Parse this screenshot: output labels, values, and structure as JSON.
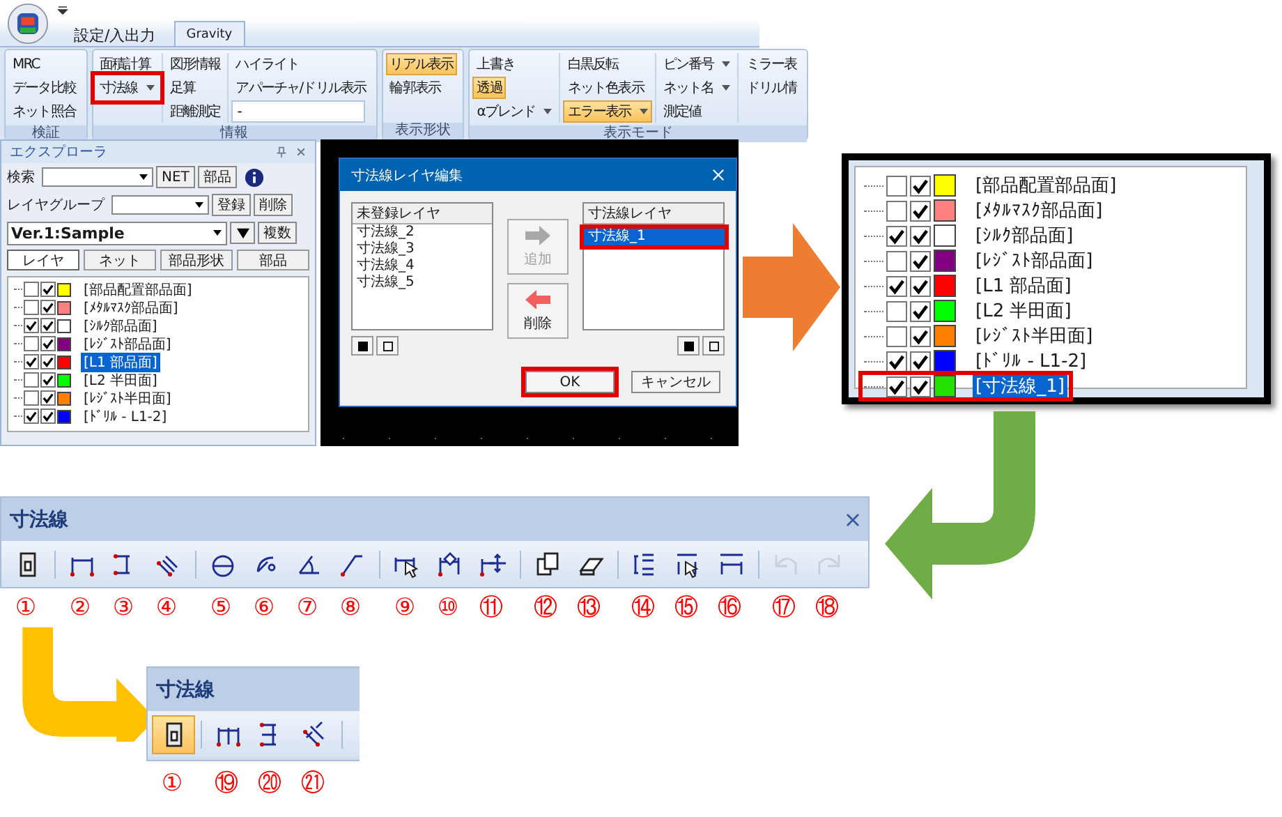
{
  "ribbon": {
    "tabs": [
      {
        "label": "設定/入出力",
        "selected": false
      },
      {
        "label": "Gravity",
        "selected": true
      }
    ],
    "groups": [
      {
        "label": "検証",
        "columns": [
          [
            {
              "kind": "button",
              "label": "MRC",
              "active": false,
              "marked": false
            },
            {
              "kind": "button",
              "label": "データ比較",
              "active": false,
              "marked": false
            },
            {
              "kind": "button",
              "label": "ネット照合",
              "active": false,
              "marked": false
            }
          ]
        ]
      },
      {
        "label": "情報",
        "columns": [
          [
            {
              "kind": "button",
              "label": "面積計算",
              "active": false,
              "marked": false
            },
            {
              "kind": "dropdown",
              "label": "寸法線",
              "active": false,
              "marked": true
            }
          ],
          [
            {
              "kind": "button",
              "label": "図形情報",
              "active": false,
              "marked": false
            },
            {
              "kind": "button",
              "label": "足算",
              "active": false,
              "marked": false
            },
            {
              "kind": "button",
              "label": "距離測定",
              "active": false,
              "marked": false
            }
          ],
          [
            {
              "kind": "button",
              "label": "ハイライト",
              "active": false,
              "marked": false
            },
            {
              "kind": "button",
              "label": "アパーチャ/ドリル表示",
              "active": false,
              "marked": false
            },
            {
              "kind": "field",
              "label": "-"
            }
          ]
        ]
      },
      {
        "label": "表示形状",
        "columns": [
          [
            {
              "kind": "button",
              "label": "リアル表示",
              "active": true,
              "marked": false
            },
            {
              "kind": "button",
              "label": "輪郭表示",
              "active": false,
              "marked": false
            }
          ]
        ]
      },
      {
        "label": "表示モード",
        "columns": [
          [
            {
              "kind": "button",
              "label": "上書き",
              "active": false,
              "marked": false
            },
            {
              "kind": "button",
              "label": "透過",
              "active": true,
              "marked": false
            },
            {
              "kind": "dropdown",
              "label": "αブレンド",
              "active": false,
              "marked": false
            }
          ],
          [
            {
              "kind": "button",
              "label": "白黒反転",
              "active": false,
              "marked": false
            },
            {
              "kind": "button",
              "label": "ネット色表示",
              "active": false,
              "marked": false
            },
            {
              "kind": "dropdown",
              "label": "エラー表示",
              "active": true,
              "marked": false
            }
          ],
          [
            {
              "kind": "dropdown",
              "label": "ピン番号",
              "active": false,
              "marked": false
            },
            {
              "kind": "dropdown",
              "label": "ネット名",
              "active": false,
              "marked": false
            },
            {
              "kind": "button",
              "label": "測定値",
              "active": false,
              "marked": false
            }
          ],
          [
            {
              "kind": "button",
              "label": "ミラー表",
              "active": false,
              "marked": false
            },
            {
              "kind": "button",
              "label": "ドリル情",
              "active": false,
              "marked": false
            }
          ]
        ]
      }
    ]
  },
  "explorer": {
    "title": "エクスプローラ",
    "search_label": "検索",
    "net_button": "NET",
    "parts_button": "部品",
    "layer_group_label": "レイヤグループ",
    "register_button": "登録",
    "delete_button": "削除",
    "version": "Ver.1:Sample",
    "multi_button": "複数",
    "tabs": [
      {
        "label": "レイヤ",
        "selected": true
      },
      {
        "label": "ネット",
        "selected": false
      },
      {
        "label": "部品形状",
        "selected": false
      },
      {
        "label": "部品",
        "selected": false
      }
    ],
    "layers": [
      {
        "name": "[部品配置部品面]",
        "checked": false,
        "visible": true,
        "color": "#ffff00",
        "selected": false
      },
      {
        "name": "[ﾒﾀﾙﾏｽｸ部品面]",
        "checked": false,
        "visible": true,
        "color": "#ff8080",
        "selected": false
      },
      {
        "name": "[ｼﾙｸ部品面]",
        "checked": true,
        "visible": true,
        "color": "#ffffff",
        "selected": false
      },
      {
        "name": "[ﾚｼﾞｽﾄ部品面]",
        "checked": false,
        "visible": true,
        "color": "#800080",
        "selected": false
      },
      {
        "name": "[L1 部品面]",
        "checked": true,
        "visible": true,
        "color": "#ff0000",
        "selected": true
      },
      {
        "name": "[L2 半田面]",
        "checked": false,
        "visible": true,
        "color": "#00ff00",
        "selected": false
      },
      {
        "name": "[ﾚｼﾞｽﾄ半田面]",
        "checked": false,
        "visible": true,
        "color": "#ff8000",
        "selected": false
      },
      {
        "name": "[ﾄﾞﾘﾙ - L1-2]",
        "checked": true,
        "visible": true,
        "color": "#0000ff",
        "selected": false
      }
    ]
  },
  "dialog": {
    "title": "寸法線レイヤ編集",
    "unregistered": {
      "header": "未登録レイヤ",
      "items": [
        "寸法線_2",
        "寸法線_3",
        "寸法線_4",
        "寸法線_5"
      ]
    },
    "add_button": {
      "label": "追加",
      "disabled": true
    },
    "remove_button": {
      "label": "削除",
      "disabled": false
    },
    "registered": {
      "header": "寸法線レイヤ",
      "items": [
        {
          "label": "寸法線_1",
          "selected": true,
          "marked": true
        }
      ]
    },
    "buttons": [
      {
        "label": "OK",
        "marked": true
      },
      {
        "label": "キャンセル",
        "marked": false
      }
    ]
  },
  "layer_panel": {
    "layers": [
      {
        "name": "[部品配置部品面]",
        "checked": false,
        "visible": true,
        "color": "#ffff00",
        "selected": false,
        "marked": false
      },
      {
        "name": "[ﾒﾀﾙﾏｽｸ部品面]",
        "checked": false,
        "visible": true,
        "color": "#ff8080",
        "selected": false,
        "marked": false
      },
      {
        "name": "[ｼﾙｸ部品面]",
        "checked": true,
        "visible": true,
        "color": "#ffffff",
        "selected": false,
        "marked": false
      },
      {
        "name": "[ﾚｼﾞｽﾄ部品面]",
        "checked": false,
        "visible": true,
        "color": "#800080",
        "selected": false,
        "marked": false
      },
      {
        "name": "[L1 部品面]",
        "checked": true,
        "visible": true,
        "color": "#ff0000",
        "selected": false,
        "marked": false
      },
      {
        "name": "[L2 半田面]",
        "checked": false,
        "visible": true,
        "color": "#00ff00",
        "selected": false,
        "marked": false
      },
      {
        "name": "[ﾚｼﾞｽﾄ半田面]",
        "checked": false,
        "visible": true,
        "color": "#ff8000",
        "selected": false,
        "marked": false
      },
      {
        "name": "[ﾄﾞﾘﾙ - L1-2]",
        "checked": true,
        "visible": true,
        "color": "#0000ff",
        "selected": false,
        "marked": false
      },
      {
        "name": "[寸法線_1]",
        "checked": true,
        "visible": true,
        "color": "#22e000",
        "selected": true,
        "marked": true
      }
    ]
  },
  "toolbar": {
    "title": "寸法線",
    "groups": [
      [
        {
          "number": "①",
          "disabled": false
        }
      ],
      [
        {
          "number": "②",
          "disabled": false
        },
        {
          "number": "③",
          "disabled": false
        },
        {
          "number": "④",
          "disabled": false
        }
      ],
      [
        {
          "number": "⑤",
          "disabled": false
        },
        {
          "number": "⑥",
          "disabled": false
        },
        {
          "number": "⑦",
          "disabled": false
        },
        {
          "number": "⑧",
          "disabled": false
        }
      ],
      [
        {
          "number": "⑨",
          "disabled": false
        },
        {
          "number": "⑩",
          "disabled": false
        },
        {
          "number": "⑪",
          "disabled": false
        }
      ],
      [
        {
          "number": "⑫",
          "disabled": false
        },
        {
          "number": "⑬",
          "disabled": false
        }
      ],
      [
        {
          "number": "⑭",
          "disabled": false
        },
        {
          "number": "⑮",
          "disabled": false
        },
        {
          "number": "⑯",
          "disabled": false
        }
      ],
      [
        {
          "number": "⑰",
          "disabled": true
        },
        {
          "number": "⑱",
          "disabled": true
        }
      ]
    ]
  },
  "toolbar_detail": {
    "title": "寸法線",
    "groups": [
      [
        {
          "number": "①",
          "selected": true
        }
      ],
      [
        {
          "number": "⑲",
          "selected": false
        },
        {
          "number": "⑳",
          "selected": false
        },
        {
          "number": "㉑",
          "selected": false
        }
      ]
    ]
  }
}
